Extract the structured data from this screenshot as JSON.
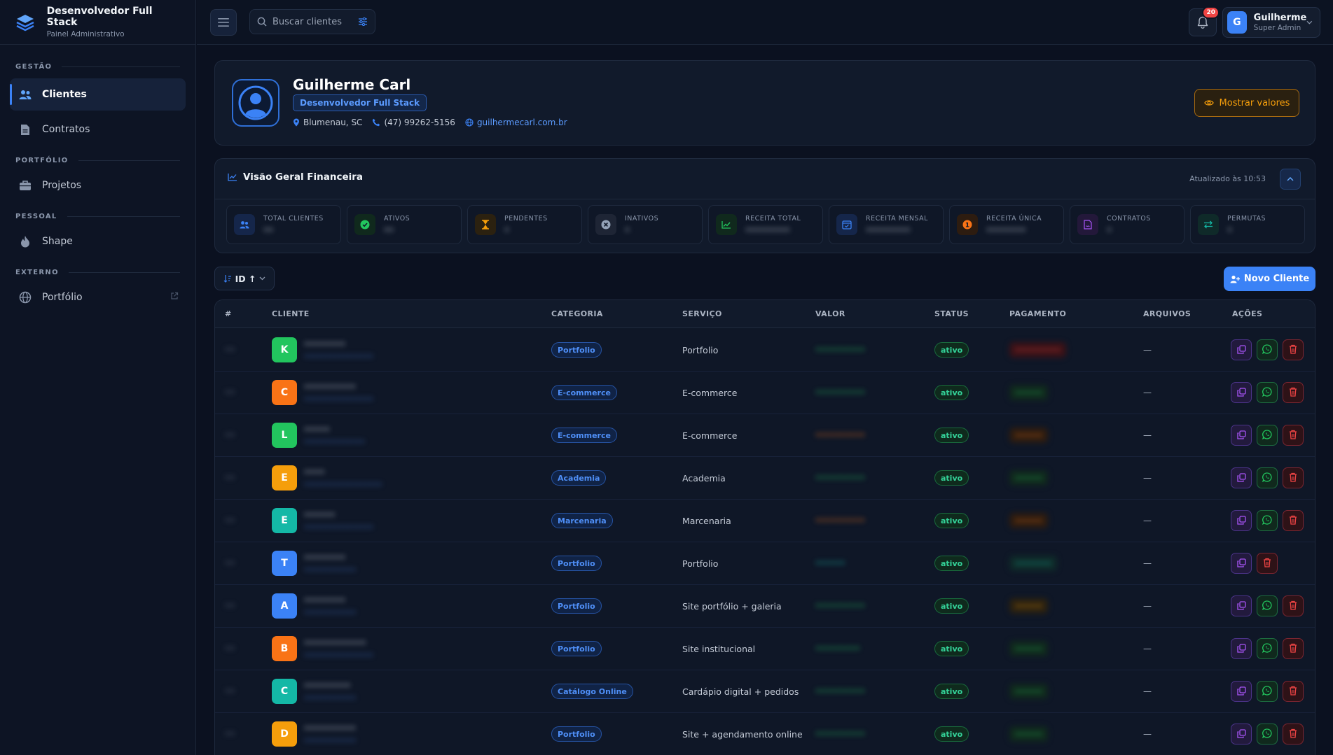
{
  "brand": {
    "title": "Desenvolvedor Full Stack",
    "subtitle": "Painel Administrativo"
  },
  "sidebar": {
    "sections": [
      {
        "title": "GESTÃO",
        "items": [
          {
            "label": "Clientes",
            "icon": "users-icon",
            "active": true
          },
          {
            "label": "Contratos",
            "icon": "document-icon",
            "active": false
          }
        ]
      },
      {
        "title": "PORTFÓLIO",
        "items": [
          {
            "label": "Projetos",
            "icon": "briefcase-icon",
            "active": false
          }
        ]
      },
      {
        "title": "PESSOAL",
        "items": [
          {
            "label": "Shape",
            "icon": "flame-icon",
            "active": false
          }
        ]
      },
      {
        "title": "EXTERNO",
        "items": [
          {
            "label": "Portfólio",
            "icon": "globe-icon",
            "active": false,
            "external": true
          }
        ]
      }
    ]
  },
  "topbar": {
    "search_placeholder": "Buscar clientes",
    "notifications_count": "20",
    "user": {
      "initial": "G",
      "name": "Guilherme",
      "role": "Super Admin"
    }
  },
  "profile": {
    "name": "Guilherme Carl",
    "tag": "Desenvolvedor Full Stack",
    "location": "Blumenau, SC",
    "phone": "(47) 99262-5156",
    "website": "guilhermecarl.com.br",
    "show_values_label": "Mostrar valores"
  },
  "finance": {
    "title": "Visão Geral Financeira",
    "updated": "Atualizado às 10:53",
    "stats": [
      {
        "label": "TOTAL CLIENTES",
        "value": "••",
        "icon": "users-icon",
        "color": "#3b82f6",
        "bg": "#15264a"
      },
      {
        "label": "ATIVOS",
        "value": "••",
        "icon": "check-circle-icon",
        "color": "#22c55e",
        "bg": "#10291d"
      },
      {
        "label": "PENDENTES",
        "value": "•",
        "icon": "hourglass-icon",
        "color": "#f59e0b",
        "bg": "#2b2110"
      },
      {
        "label": "INATIVOS",
        "value": "•",
        "icon": "x-circle-icon",
        "color": "#94a3b8",
        "bg": "#1e2535"
      },
      {
        "label": "RECEITA TOTAL",
        "value": "•••••••••",
        "icon": "trend-up-icon",
        "color": "#22c55e",
        "bg": "#10291d"
      },
      {
        "label": "RECEITA MENSAL",
        "value": "•••••••••",
        "icon": "calendar-icon",
        "color": "#3b82f6",
        "bg": "#15264a"
      },
      {
        "label": "RECEITA ÚNICA",
        "value": "••••••••",
        "icon": "one-time-icon",
        "color": "#f97316",
        "bg": "#2d1c10"
      },
      {
        "label": "CONTRATOS",
        "value": "•",
        "icon": "contract-icon",
        "color": "#a855f7",
        "bg": "#23183a"
      },
      {
        "label": "PERMUTAS",
        "value": "•",
        "icon": "swap-icon",
        "color": "#14b8a6",
        "bg": "#0f2a29"
      }
    ]
  },
  "toolbar": {
    "sort_label": "ID ↑",
    "new_client_label": "Novo Cliente"
  },
  "table": {
    "headers": [
      "#",
      "CLIENTE",
      "CATEGORIA",
      "SERVIÇO",
      "VALOR",
      "STATUS",
      "PAGAMENTO",
      "ARQUIVOS",
      "AÇÕES"
    ],
    "rows": [
      {
        "id": "••",
        "initial": "K",
        "color": "#22c55e",
        "name": "••••••••",
        "email": "••••••••••••••••",
        "category": "Portfolio",
        "service": "Portfolio",
        "value": "••••••••••",
        "value_color": "#22c55e",
        "status": "ativo",
        "payment": "••••••••••",
        "pay_color": "#ef4444",
        "pay_bg": "#3a1217",
        "files": "—",
        "whatsapp": true
      },
      {
        "id": "••",
        "initial": "C",
        "color": "#f97316",
        "name": "••••••••••",
        "email": "••••••••••••••••",
        "category": "E-commerce",
        "service": "E-commerce",
        "value": "••••••••••",
        "value_color": "#22c55e",
        "status": "ativo",
        "payment": "••••••",
        "pay_color": "#22c55e",
        "pay_bg": "#10291d",
        "files": "—",
        "whatsapp": true
      },
      {
        "id": "••",
        "initial": "L",
        "color": "#22c55e",
        "name": "•••••",
        "email": "••••••••••••••",
        "category": "E-commerce",
        "service": "E-commerce",
        "value": "••••••••••",
        "value_color": "#f97316",
        "status": "ativo",
        "payment": "••••••",
        "pay_color": "#f97316",
        "pay_bg": "#2d1c10",
        "files": "—",
        "whatsapp": true
      },
      {
        "id": "••",
        "initial": "E",
        "color": "#f59e0b",
        "name": "••••",
        "email": "••••••••••••••••••",
        "category": "Academia",
        "service": "Academia",
        "value": "••••••••••",
        "value_color": "#22c55e",
        "status": "ativo",
        "payment": "••••••",
        "pay_color": "#22c55e",
        "pay_bg": "#10291d",
        "files": "—",
        "whatsapp": true
      },
      {
        "id": "••",
        "initial": "E",
        "color": "#14b8a6",
        "name": "••••••",
        "email": "••••••••••••••••",
        "category": "Marcenaria",
        "service": "Marcenaria",
        "value": "••••••••••",
        "value_color": "#f97316",
        "status": "ativo",
        "payment": "••••••",
        "pay_color": "#f97316",
        "pay_bg": "#2d1c10",
        "files": "—",
        "whatsapp": true
      },
      {
        "id": "••",
        "initial": "T",
        "color": "#3b82f6",
        "name": "••••••••",
        "email": "••••••••••••",
        "category": "Portfolio",
        "service": "Portfolio",
        "value": "••••••",
        "value_color": "#14b8a6",
        "status": "ativo",
        "payment": "••••••••",
        "pay_color": "#14b8a6",
        "pay_bg": "#0f2a29",
        "files": "—",
        "whatsapp": false
      },
      {
        "id": "••",
        "initial": "A",
        "color": "#3b82f6",
        "name": "••••••••",
        "email": "••••••••••••",
        "category": "Portfolio",
        "service": "Site portfólio + galeria",
        "value": "••••••••••",
        "value_color": "#22c55e",
        "status": "ativo",
        "payment": "••••••",
        "pay_color": "#f59e0b",
        "pay_bg": "#2b2110",
        "files": "—",
        "whatsapp": true
      },
      {
        "id": "••",
        "initial": "B",
        "color": "#f97316",
        "name": "••••••••••••",
        "email": "••••••••••••••••",
        "category": "Portfolio",
        "service": "Site institucional",
        "value": "•••••••••",
        "value_color": "#22c55e",
        "status": "ativo",
        "payment": "••••••",
        "pay_color": "#22c55e",
        "pay_bg": "#10291d",
        "files": "—",
        "whatsapp": true
      },
      {
        "id": "••",
        "initial": "C",
        "color": "#14b8a6",
        "name": "•••••••••",
        "email": "••••••••••••",
        "category": "Catálogo Online",
        "service": "Cardápio digital + pedidos",
        "value": "••••••••••",
        "value_color": "#22c55e",
        "status": "ativo",
        "payment": "••••••",
        "pay_color": "#22c55e",
        "pay_bg": "#10291d",
        "files": "—",
        "whatsapp": true
      },
      {
        "id": "••",
        "initial": "D",
        "color": "#f59e0b",
        "name": "••••••••••",
        "email": "••••••••••••",
        "category": "Portfolio",
        "service": "Site + agendamento online",
        "value": "••••••••••",
        "value_color": "#22c55e",
        "status": "ativo",
        "payment": "••••••",
        "pay_color": "#22c55e",
        "pay_bg": "#10291d",
        "files": "—",
        "whatsapp": true
      }
    ]
  }
}
